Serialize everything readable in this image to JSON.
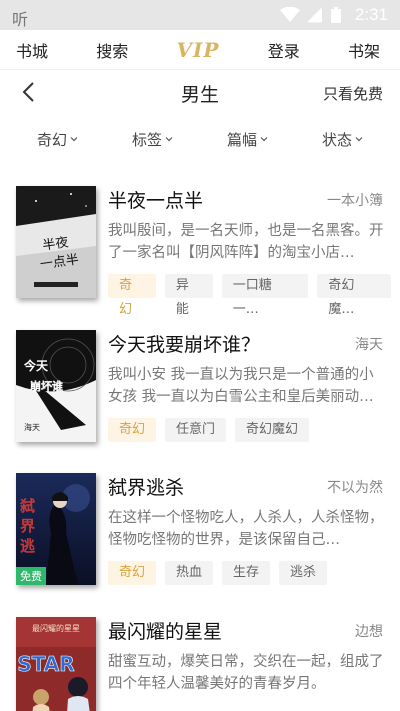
{
  "status_bar": {
    "app_glyph": "听",
    "time": "2:31"
  },
  "top_nav": [
    "书城",
    "搜索",
    "VIP",
    "登录",
    "书架"
  ],
  "title_bar": {
    "title": "男生",
    "free_only": "只看免费"
  },
  "filters": [
    "奇幻",
    "标签",
    "篇幅",
    "状态"
  ],
  "books": [
    {
      "title": "半夜一点半",
      "author": "一本小簿",
      "desc": "我叫殷间，是一名天师，也是一名黑客。开了一家名叫【阴风阵阵】的淘宝小店…",
      "tags": [
        "奇幻",
        "异能",
        "一口糖一…",
        "奇幻魔…"
      ],
      "cover_text": "半夜一点半",
      "free": false
    },
    {
      "title": "今天我要崩坏谁？",
      "author": "海天",
      "desc": "我叫小安 我一直以为我只是一个普通的小女孩 我一直以为白雪公主和皇后美丽动…",
      "tags": [
        "奇幻",
        "任意门",
        "奇幻魔幻"
      ],
      "cover_text": "今天我要崩坏谁",
      "free": false
    },
    {
      "title": "弑界逃杀",
      "author": "不以为然",
      "desc": "在这样一个怪物吃人，人杀人，人杀怪物，怪物吃怪物的世界，是该保留自己…",
      "tags": [
        "奇幻",
        "热血",
        "生存",
        "逃杀"
      ],
      "cover_text": "弑界逃杀",
      "free": true,
      "free_label": "免费"
    },
    {
      "title": "最闪耀的星星",
      "author": "边想",
      "desc": "甜蜜互动，爆笑日常，交织在一起，组成了四个年轻人温馨美好的青春岁月。",
      "tags": [],
      "cover_text": "STAR",
      "free": false
    }
  ]
}
